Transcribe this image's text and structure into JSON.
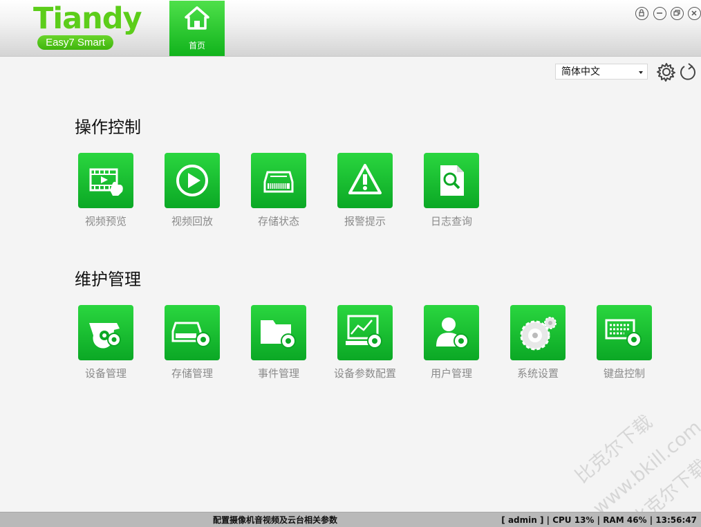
{
  "logo": {
    "brand": "Tiandy",
    "product": "Easy7 Smart"
  },
  "nav": {
    "home_label": "首页"
  },
  "window_controls": [
    "lock-icon",
    "minimize-icon",
    "restore-icon",
    "close-icon"
  ],
  "language": {
    "selected": "简体中文"
  },
  "sections": {
    "operation": {
      "title": "操作控制",
      "items": [
        {
          "label": "视频预览",
          "icon": "video-preview-icon"
        },
        {
          "label": "视频回放",
          "icon": "video-playback-icon"
        },
        {
          "label": "存储状态",
          "icon": "storage-status-icon"
        },
        {
          "label": "报警提示",
          "icon": "alarm-warning-icon"
        },
        {
          "label": "日志查询",
          "icon": "log-search-icon"
        }
      ]
    },
    "maintenance": {
      "title": "维护管理",
      "items": [
        {
          "label": "设备管理",
          "icon": "device-management-icon"
        },
        {
          "label": "存储管理",
          "icon": "storage-management-icon"
        },
        {
          "label": "事件管理",
          "icon": "event-management-icon"
        },
        {
          "label": "设备参数配置",
          "icon": "device-parameter-config-icon"
        },
        {
          "label": "用户管理",
          "icon": "user-management-icon"
        },
        {
          "label": "系统设置",
          "icon": "system-settings-icon"
        },
        {
          "label": "键盘控制",
          "icon": "keyboard-control-icon"
        }
      ]
    }
  },
  "statusbar": {
    "message": "配置摄像机音视频及云台相关参数",
    "info": "[ admin ] | CPU  13% | RAM  46% | 13:56:47"
  },
  "watermark": {
    "line1": "比克尔下载",
    "line2": "www.bkill.com",
    "line3": "比克尔下载"
  },
  "colors": {
    "accent": "#11b31c",
    "tile_top": "#2ad63f",
    "tile_bottom": "#0ba825",
    "brand_green": "#5ccd1a"
  }
}
